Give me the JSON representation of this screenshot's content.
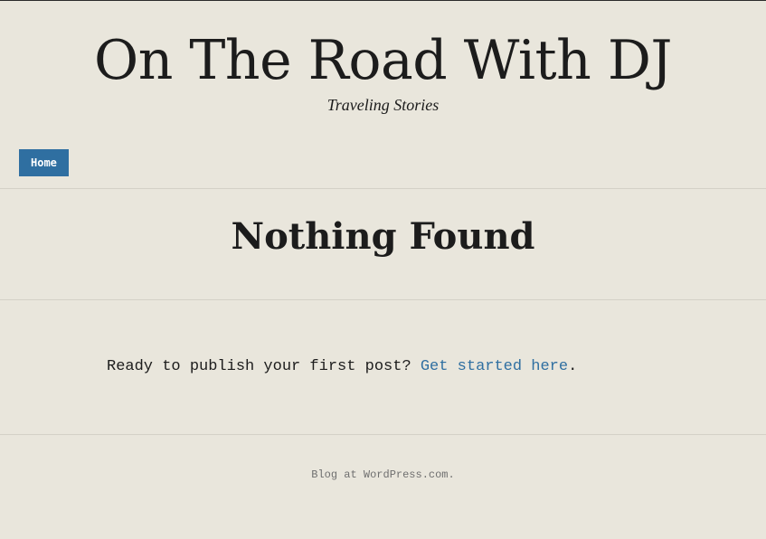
{
  "header": {
    "site_title": "On The Road With DJ",
    "tagline": "Traveling Stories"
  },
  "nav": {
    "items": [
      {
        "label": "Home"
      }
    ]
  },
  "main": {
    "page_title": "Nothing Found",
    "message": "Ready to publish your first post?",
    "link_label": "Get started here",
    "punctuation": "."
  },
  "footer": {
    "credit": "Blog at WordPress.com."
  },
  "colors": {
    "background": "#e9e6dc",
    "accent": "#2f6fa1",
    "text": "#1c1c1c"
  }
}
